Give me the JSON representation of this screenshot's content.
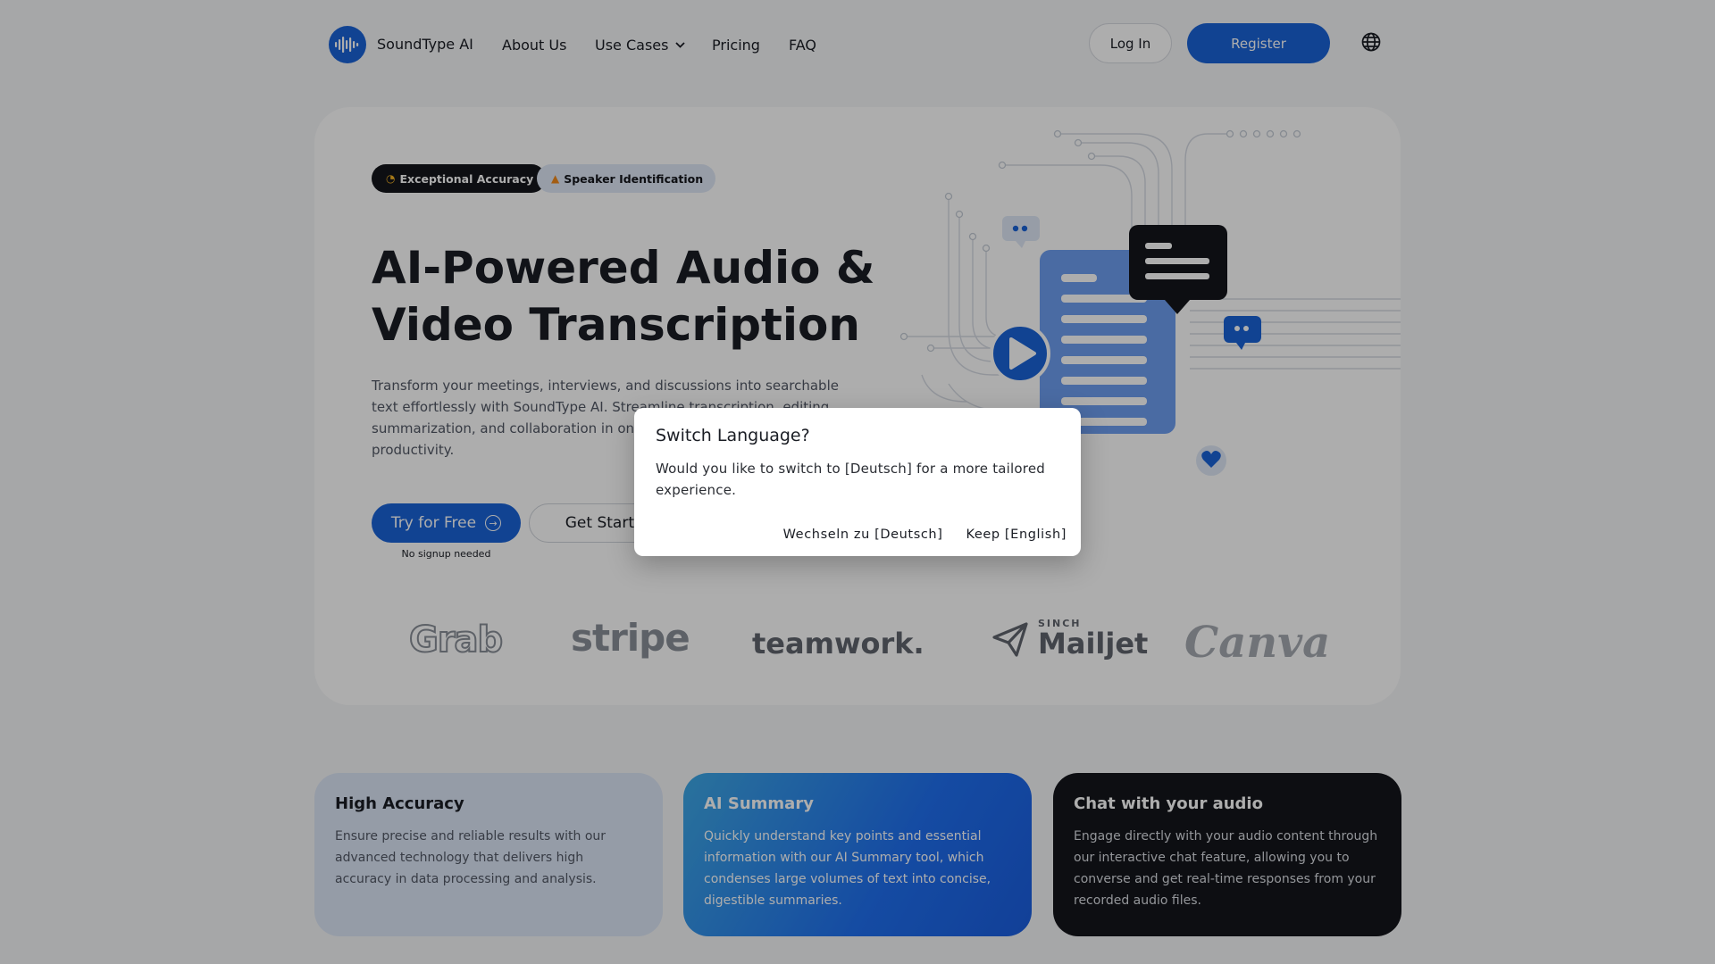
{
  "nav": {
    "brand": "SoundType AI",
    "links": {
      "about": "About Us",
      "use_cases": "Use Cases",
      "pricing": "Pricing",
      "faq": "FAQ"
    },
    "login": "Log In",
    "register": "Register",
    "globe_icon": "globe-icon"
  },
  "hero": {
    "badges": [
      {
        "icon": "ear-icon",
        "label": "Exceptional Accuracy"
      },
      {
        "icon": "fire-icon",
        "label": "Speaker Identification"
      }
    ],
    "title_line1": "AI-Powered Audio &",
    "title_line2": "Video Transcription",
    "description": "Transform your meetings, interviews, and discussions into searchable text effortlessly with SoundType AI. Streamline transcription, editing, summarization, and collaboration in one intuitive platform to maximize productivity.",
    "try_button": "Try for Free",
    "start_button": "Get Started",
    "no_signup": "No signup needed"
  },
  "partners": [
    "Grab",
    "stripe",
    "teamwork.",
    "SINCH",
    "Mailjet",
    "Canva"
  ],
  "features": [
    {
      "title": "High Accuracy",
      "text": "Ensure precise and reliable results with our advanced technology that delivers high accuracy in data processing and analysis."
    },
    {
      "title": "AI Summary",
      "text": "Quickly understand key points and essential information with our AI Summary tool, which condenses large volumes of text into concise, digestible summaries."
    },
    {
      "title": "Chat with your audio",
      "text": "Engage directly with your audio content through our interactive chat feature, allowing you to converse and get real-time responses from your recorded audio files."
    }
  ],
  "dialog": {
    "title": "Switch Language?",
    "message": "Would you like to switch to [Deutsch] for a more tailored experience.",
    "switch_label": "Wechseln zu [Deutsch]",
    "keep_label": "Keep [English]"
  },
  "colors": {
    "brand_blue": "#1a63d8",
    "dark": "#14161b",
    "overlay": "rgba(0,0,0,0.32)"
  }
}
